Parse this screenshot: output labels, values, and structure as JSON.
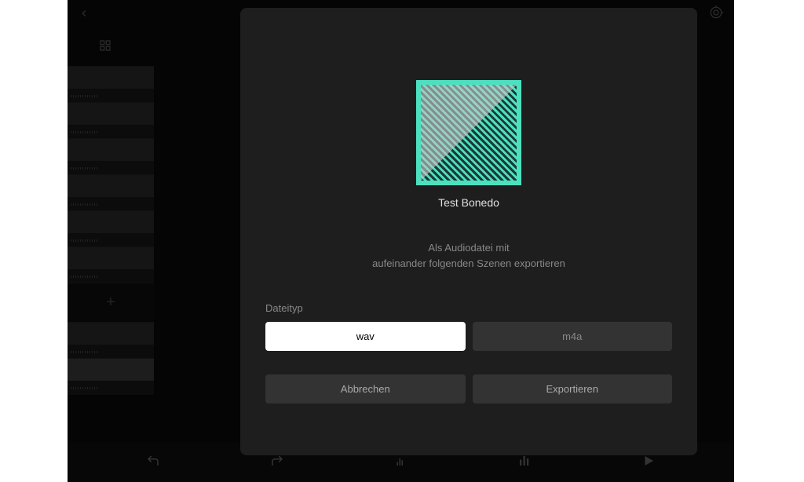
{
  "project": {
    "name": "Test Bonedo"
  },
  "export": {
    "description_line1": "Als Audiodatei mit",
    "description_line2": "aufeinander folgenden Szenen exportieren",
    "filetype_label": "Dateityp",
    "options": {
      "wav": "wav",
      "m4a": "m4a"
    },
    "selected": "wav"
  },
  "actions": {
    "cancel": "Abbrechen",
    "export": "Exportieren"
  }
}
